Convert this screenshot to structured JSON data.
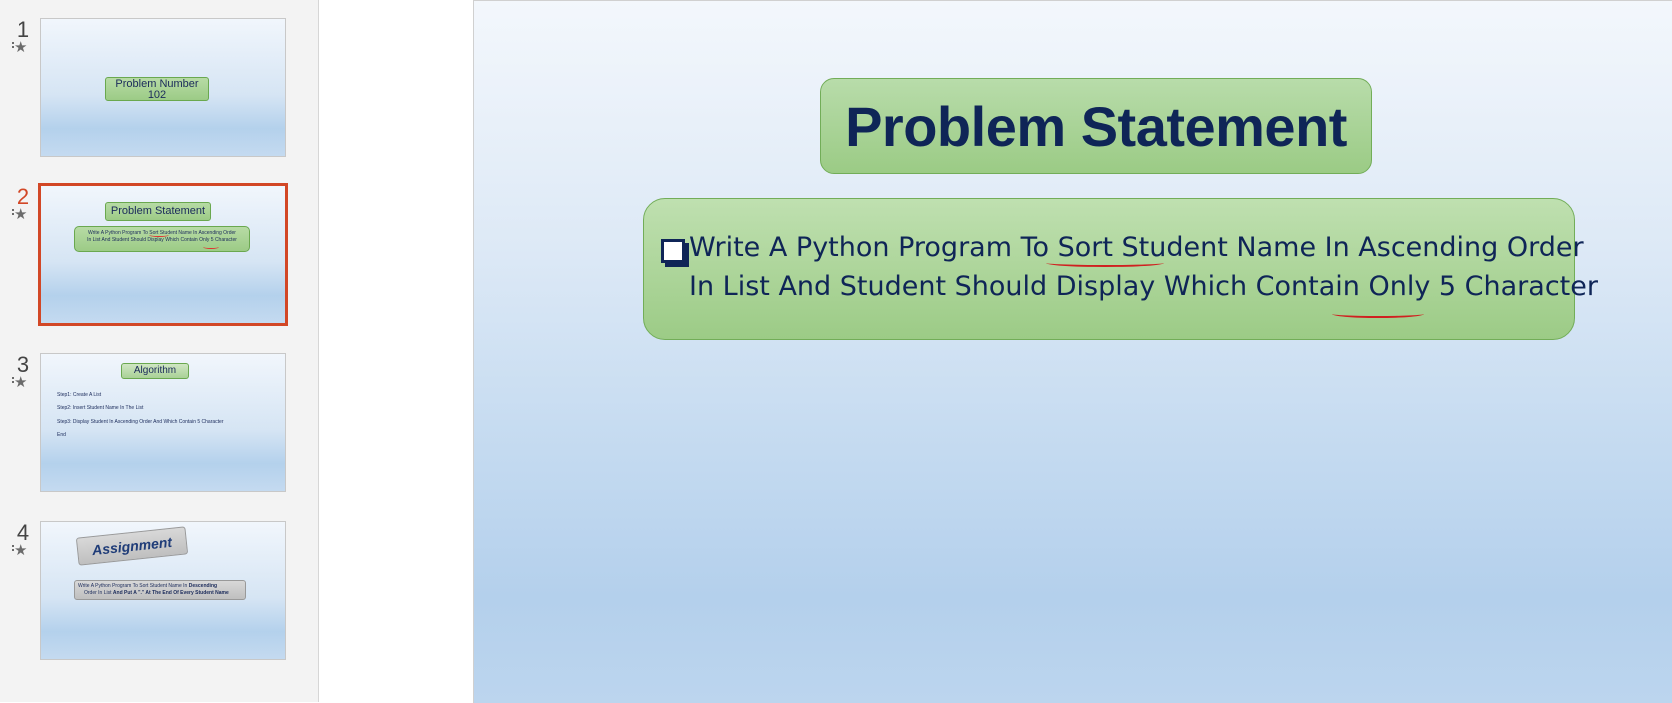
{
  "thumbnails": [
    {
      "number": "1",
      "box_text_line1": "Problem Number",
      "box_text_line2": "102"
    },
    {
      "number": "2",
      "title": "Problem Statement",
      "line1": "Write A Python Program To Sort Student Name In Ascending Order",
      "line2": "In List And Student Should Display Which Contain Only 5 Character"
    },
    {
      "number": "3",
      "title": "Algorithm",
      "steps": [
        "Step1: Create A List",
        "Step2: Insert Student Name In The List",
        "Step3: Display Student In Ascending Order And Which Contain 5 Character",
        "End"
      ]
    },
    {
      "number": "4",
      "title": "Assignment",
      "line1_plain": "Write A Python Program To Sort Student Name In",
      "line1_bold": "Descending",
      "line2_plain": "Order In List",
      "line2_bold": "And Put A \".\" At The End Of Every Student Name"
    }
  ],
  "slide": {
    "title": "Problem Statement",
    "line1": "Write A Python Program To Sort Student Name In Ascending Order",
    "line2": "In List And Student Should Display Which Contain Only 5 Character"
  },
  "colors": {
    "accent_selected": "#d24726",
    "title_text": "#0f2557",
    "box_green": "#9ccb86"
  },
  "icons": [
    "animation-star-icon",
    "bullet-square-icon"
  ]
}
